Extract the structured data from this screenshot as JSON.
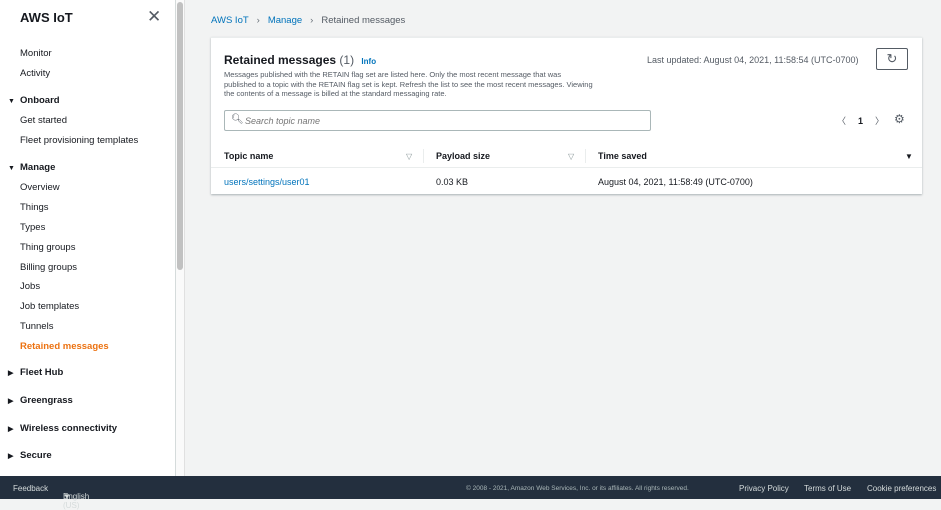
{
  "sidebar": {
    "title": "AWS IoT",
    "items": {
      "monitor": "Monitor",
      "activity": "Activity",
      "onboard": "Onboard",
      "get_started": "Get started",
      "fleet_prov": "Fleet provisioning templates",
      "manage": "Manage",
      "overview": "Overview",
      "things": "Things",
      "types": "Types",
      "thing_groups": "Thing groups",
      "billing_groups": "Billing groups",
      "jobs": "Jobs",
      "job_templates": "Job templates",
      "tunnels": "Tunnels",
      "retained": "Retained messages",
      "fleet_hub": "Fleet Hub",
      "greengrass": "Greengrass",
      "wireless": "Wireless connectivity",
      "secure": "Secure"
    }
  },
  "breadcrumb": [
    "AWS IoT",
    "Manage",
    "Retained messages"
  ],
  "card": {
    "title": "Retained messages",
    "count": "(1)",
    "info": "Info",
    "description": "Messages published with the RETAIN flag set are listed here. Only the most recent message that was published to a topic with the RETAIN flag set is kept. Refresh the list to see the most recent messages. Viewing the contents of a message is billed at the standard messaging rate.",
    "last_updated": "Last updated: August 04, 2021, 11:58:54 (UTC-0700)",
    "search_placeholder": "Search topic name",
    "page": "1"
  },
  "table": {
    "columns": [
      "Topic name",
      "Payload size",
      "Time saved"
    ],
    "rows": [
      {
        "topic": "users/settings/user01",
        "size": "0.03 KB",
        "time": "August 04, 2021, 11:58:49 (UTC-0700)"
      }
    ]
  },
  "footer": {
    "feedback": "Feedback",
    "language": "English (US)",
    "copyright": "© 2008 - 2021, Amazon Web Services, Inc. or its affiliates. All rights reserved.",
    "privacy": "Privacy Policy",
    "terms": "Terms of Use",
    "cookies": "Cookie preferences"
  }
}
